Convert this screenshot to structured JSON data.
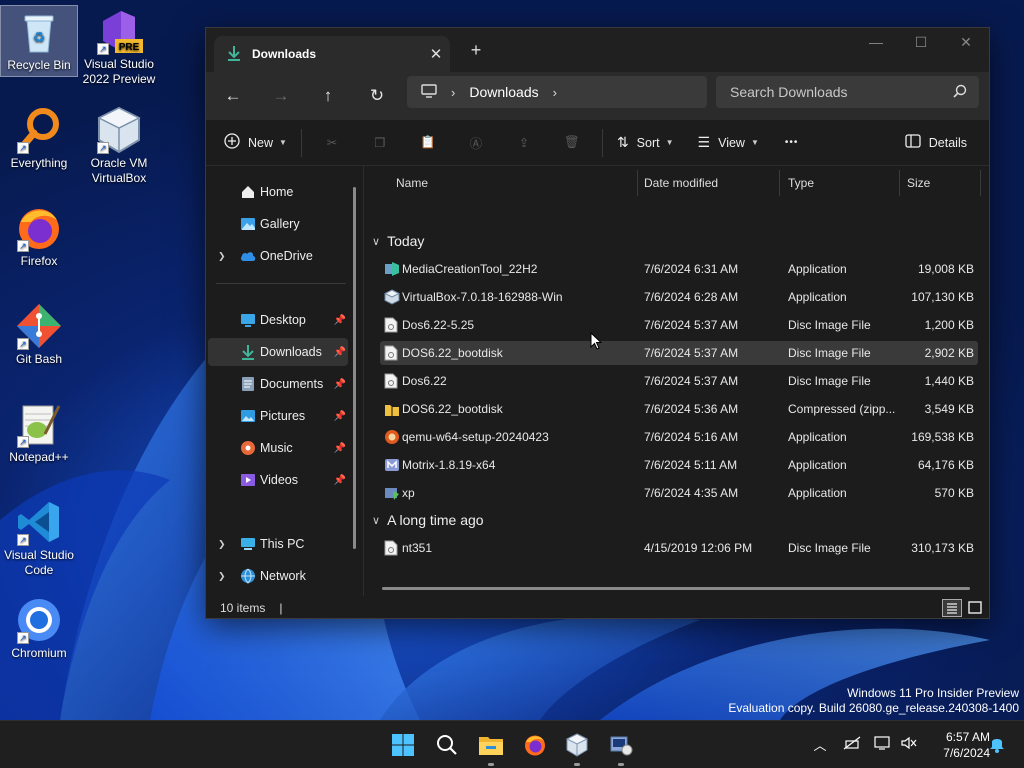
{
  "desktop": {
    "icons": [
      {
        "label": "Recycle Bin",
        "icon": "recycle-bin-icon"
      },
      {
        "label": "Visual Studio 2022 Preview",
        "icon": "visual-studio-preview-icon",
        "badge": "PRE"
      },
      {
        "label": "Everything",
        "icon": "everything-search-icon"
      },
      {
        "label": "Oracle VM VirtualBox",
        "icon": "virtualbox-icon"
      },
      {
        "label": "Firefox",
        "icon": "firefox-icon"
      },
      {
        "label": "Git Bash",
        "icon": "git-bash-icon"
      },
      {
        "label": "Notepad++",
        "icon": "notepad-plus-plus-icon"
      },
      {
        "label": "Visual Studio Code",
        "icon": "vscode-icon"
      },
      {
        "label": "Chromium",
        "icon": "chromium-icon"
      }
    ]
  },
  "explorer": {
    "tab_title": "Downloads",
    "address": {
      "segments": [
        "Downloads"
      ]
    },
    "search_placeholder": "Search Downloads",
    "toolbar": {
      "new_label": "New",
      "sort_label": "Sort",
      "view_label": "View",
      "more_label": "•••",
      "details_label": "Details"
    },
    "sidebar": {
      "items": [
        {
          "label": "Home",
          "icon": "home-icon"
        },
        {
          "label": "Gallery",
          "icon": "gallery-icon"
        },
        {
          "label": "OneDrive",
          "icon": "onedrive-icon"
        },
        {
          "label": "Desktop",
          "icon": "desktop-folder-icon",
          "pinned": true
        },
        {
          "label": "Downloads",
          "icon": "downloads-icon",
          "pinned": true,
          "active": true
        },
        {
          "label": "Documents",
          "icon": "documents-icon",
          "pinned": true
        },
        {
          "label": "Pictures",
          "icon": "pictures-icon",
          "pinned": true
        },
        {
          "label": "Music",
          "icon": "music-icon",
          "pinned": true
        },
        {
          "label": "Videos",
          "icon": "videos-icon",
          "pinned": true
        },
        {
          "label": "This PC",
          "icon": "this-pc-icon"
        },
        {
          "label": "Network",
          "icon": "network-icon"
        }
      ]
    },
    "columns": [
      "Name",
      "Date modified",
      "Type",
      "Size"
    ],
    "groups": [
      {
        "label": "Today",
        "files": [
          {
            "name": "MediaCreationTool_22H2",
            "date": "7/6/2024 6:31 AM",
            "type": "Application",
            "size": "19,008 KB",
            "icon": "media-creation-tool-icon"
          },
          {
            "name": "VirtualBox-7.0.18-162988-Win",
            "date": "7/6/2024 6:28 AM",
            "type": "Application",
            "size": "107,130 KB",
            "icon": "virtualbox-installer-icon"
          },
          {
            "name": "Dos6.22-5.25",
            "date": "7/6/2024 5:37 AM",
            "type": "Disc Image File",
            "size": "1,200 KB",
            "icon": "disc-image-file-icon"
          },
          {
            "name": "DOS6.22_bootdisk",
            "date": "7/6/2024 5:37 AM",
            "type": "Disc Image File",
            "size": "2,902 KB",
            "icon": "disc-image-file-icon",
            "selected": true
          },
          {
            "name": "Dos6.22",
            "date": "7/6/2024 5:37 AM",
            "type": "Disc Image File",
            "size": "1,440 KB",
            "icon": "disc-image-file-icon"
          },
          {
            "name": "DOS6.22_bootdisk",
            "date": "7/6/2024 5:36 AM",
            "type": "Compressed (zipp...",
            "size": "3,549 KB",
            "icon": "zip-folder-icon"
          },
          {
            "name": "qemu-w64-setup-20240423",
            "date": "7/6/2024 5:16 AM",
            "type": "Application",
            "size": "169,538 KB",
            "icon": "qemu-installer-icon"
          },
          {
            "name": "Motrix-1.8.19-x64",
            "date": "7/6/2024 5:11 AM",
            "type": "Application",
            "size": "64,176 KB",
            "icon": "motrix-installer-icon"
          },
          {
            "name": "xp",
            "date": "7/6/2024 4:35 AM",
            "type": "Application",
            "size": "570 KB",
            "icon": "xp-installer-icon"
          }
        ]
      },
      {
        "label": "A long time ago",
        "files": [
          {
            "name": "nt351",
            "date": "4/15/2019 12:06 PM",
            "type": "Disc Image File",
            "size": "310,173 KB",
            "icon": "disc-image-file-icon"
          }
        ]
      }
    ],
    "status": {
      "item_count": "10 items"
    }
  },
  "watermark": {
    "line1": "Windows 11 Pro Insider Preview",
    "line2": "Evaluation copy. Build 26080.ge_release.240308-1400"
  },
  "taskbar": {
    "apps": [
      "start-icon",
      "search-icon",
      "file-explorer-icon",
      "firefox-icon",
      "virtualbox-icon",
      "dos-setup-icon"
    ],
    "clock": {
      "time": "6:57 AM",
      "date": "7/6/2024"
    }
  },
  "colors": {
    "accent_blue": "#4cc2ff",
    "download_green": "#3fb59a",
    "window_bg": "#1c1c1c"
  }
}
